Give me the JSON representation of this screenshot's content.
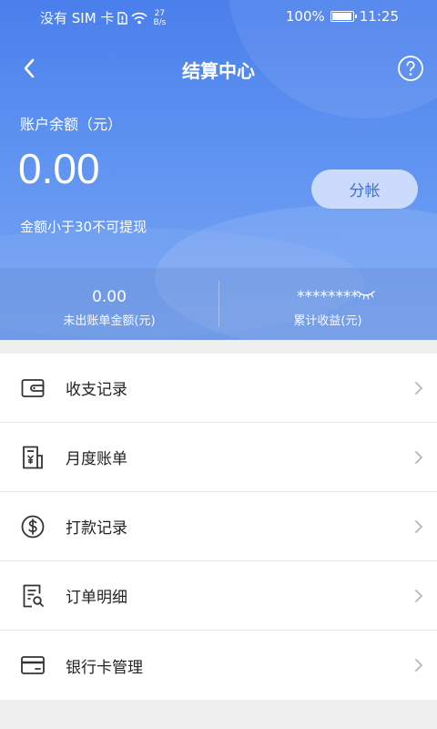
{
  "status_bar": {
    "carrier": "没有 SIM 卡",
    "speed_value": "27",
    "speed_unit": "B/s",
    "battery": "100%",
    "time": "11:25"
  },
  "nav": {
    "title": "结算中心",
    "back_icon": "chevron-left-icon",
    "help_icon": "question-circle-icon"
  },
  "balance": {
    "label": "账户余额（元）",
    "value": "0.00",
    "split_button": "分帐",
    "note": "金额小于30不可提现"
  },
  "stats": {
    "unbilled_value": "0.00",
    "unbilled_label": "未出账单金额(元)",
    "earnings_value": "********",
    "earnings_label": "累计收益(元)"
  },
  "menu": [
    {
      "label": "收支记录",
      "icon": "wallet-icon"
    },
    {
      "label": "月度账单",
      "icon": "bill-icon"
    },
    {
      "label": "打款记录",
      "icon": "dollar-circle-icon"
    },
    {
      "label": "订单明细",
      "icon": "order-search-icon"
    },
    {
      "label": "银行卡管理",
      "icon": "bank-card-icon"
    }
  ],
  "colors": {
    "header_top": "#4a7fec",
    "header_bottom": "#79a6f3",
    "split_button_text": "#3f6fd8",
    "page_bg": "#efeff0"
  }
}
